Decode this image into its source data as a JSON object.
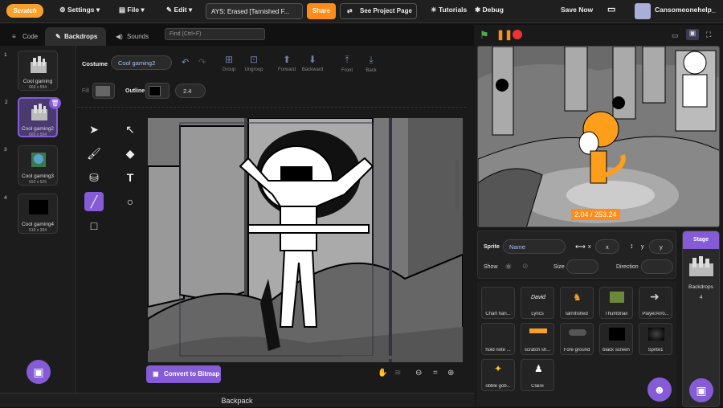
{
  "menu": {
    "logo": "Scratch",
    "settings": "Settings",
    "file": "File",
    "edit": "Edit",
    "project_title": "AYS: Erased [Tarnished F...",
    "share": "Share",
    "see_project": "See Project Page",
    "tutorials": "Tutorials",
    "debug": "Debug",
    "save_now": "Save Now",
    "username": "Cansomeonehelp_"
  },
  "tabs": {
    "code": "Code",
    "backdrops": "Backdrops",
    "sounds": "Sounds",
    "find_placeholder": "Find (Ctrl+F)"
  },
  "costumes": [
    {
      "num": "1",
      "name": "Cool gaming",
      "size": "669 x 594"
    },
    {
      "num": "2",
      "name": "Cool gaming2",
      "size": "669 x 594"
    },
    {
      "num": "3",
      "name": "Cool gaming3",
      "size": "592 x 525"
    },
    {
      "num": "4",
      "name": "Cool gaming4",
      "size": "510 x 394"
    }
  ],
  "editor": {
    "costume_label": "Costume",
    "costume_name": "Cool gaming2",
    "group": "Group",
    "ungroup": "Ungroup",
    "forward": "Forward",
    "backward": "Backward",
    "front": "Front",
    "back": "Back",
    "fill": "Fill",
    "outline": "Outline",
    "outline_width": "2.4",
    "convert": "Convert to Bitmap"
  },
  "stage": {
    "readout": "2.04 / 253.24"
  },
  "sprite_info": {
    "sprite": "Sprite",
    "name_placeholder": "Name",
    "x": "x",
    "y": "y",
    "show": "Show",
    "size": "Size",
    "direction": "Direction"
  },
  "sprites": [
    {
      "name": "Chart han..."
    },
    {
      "name": "Lyrics"
    },
    {
      "name": "tarnifished"
    },
    {
      "name": "Thumbnail"
    },
    {
      "name": "PlayerArro..."
    },
    {
      "name": "hold note ..."
    },
    {
      "name": "scratch sh..."
    },
    {
      "name": "Fore ground"
    },
    {
      "name": "black screen"
    },
    {
      "name": "Sprite1"
    },
    {
      "name": "obble gob..."
    },
    {
      "name": "Claire"
    }
  ],
  "stage_col": {
    "label": "Stage",
    "backdrops": "Backdrops",
    "count": "4"
  },
  "backpack": "Backpack",
  "colors": {
    "accent": "#855cd6",
    "share": "#ff8c1a",
    "readout": "#ff8c1a"
  }
}
